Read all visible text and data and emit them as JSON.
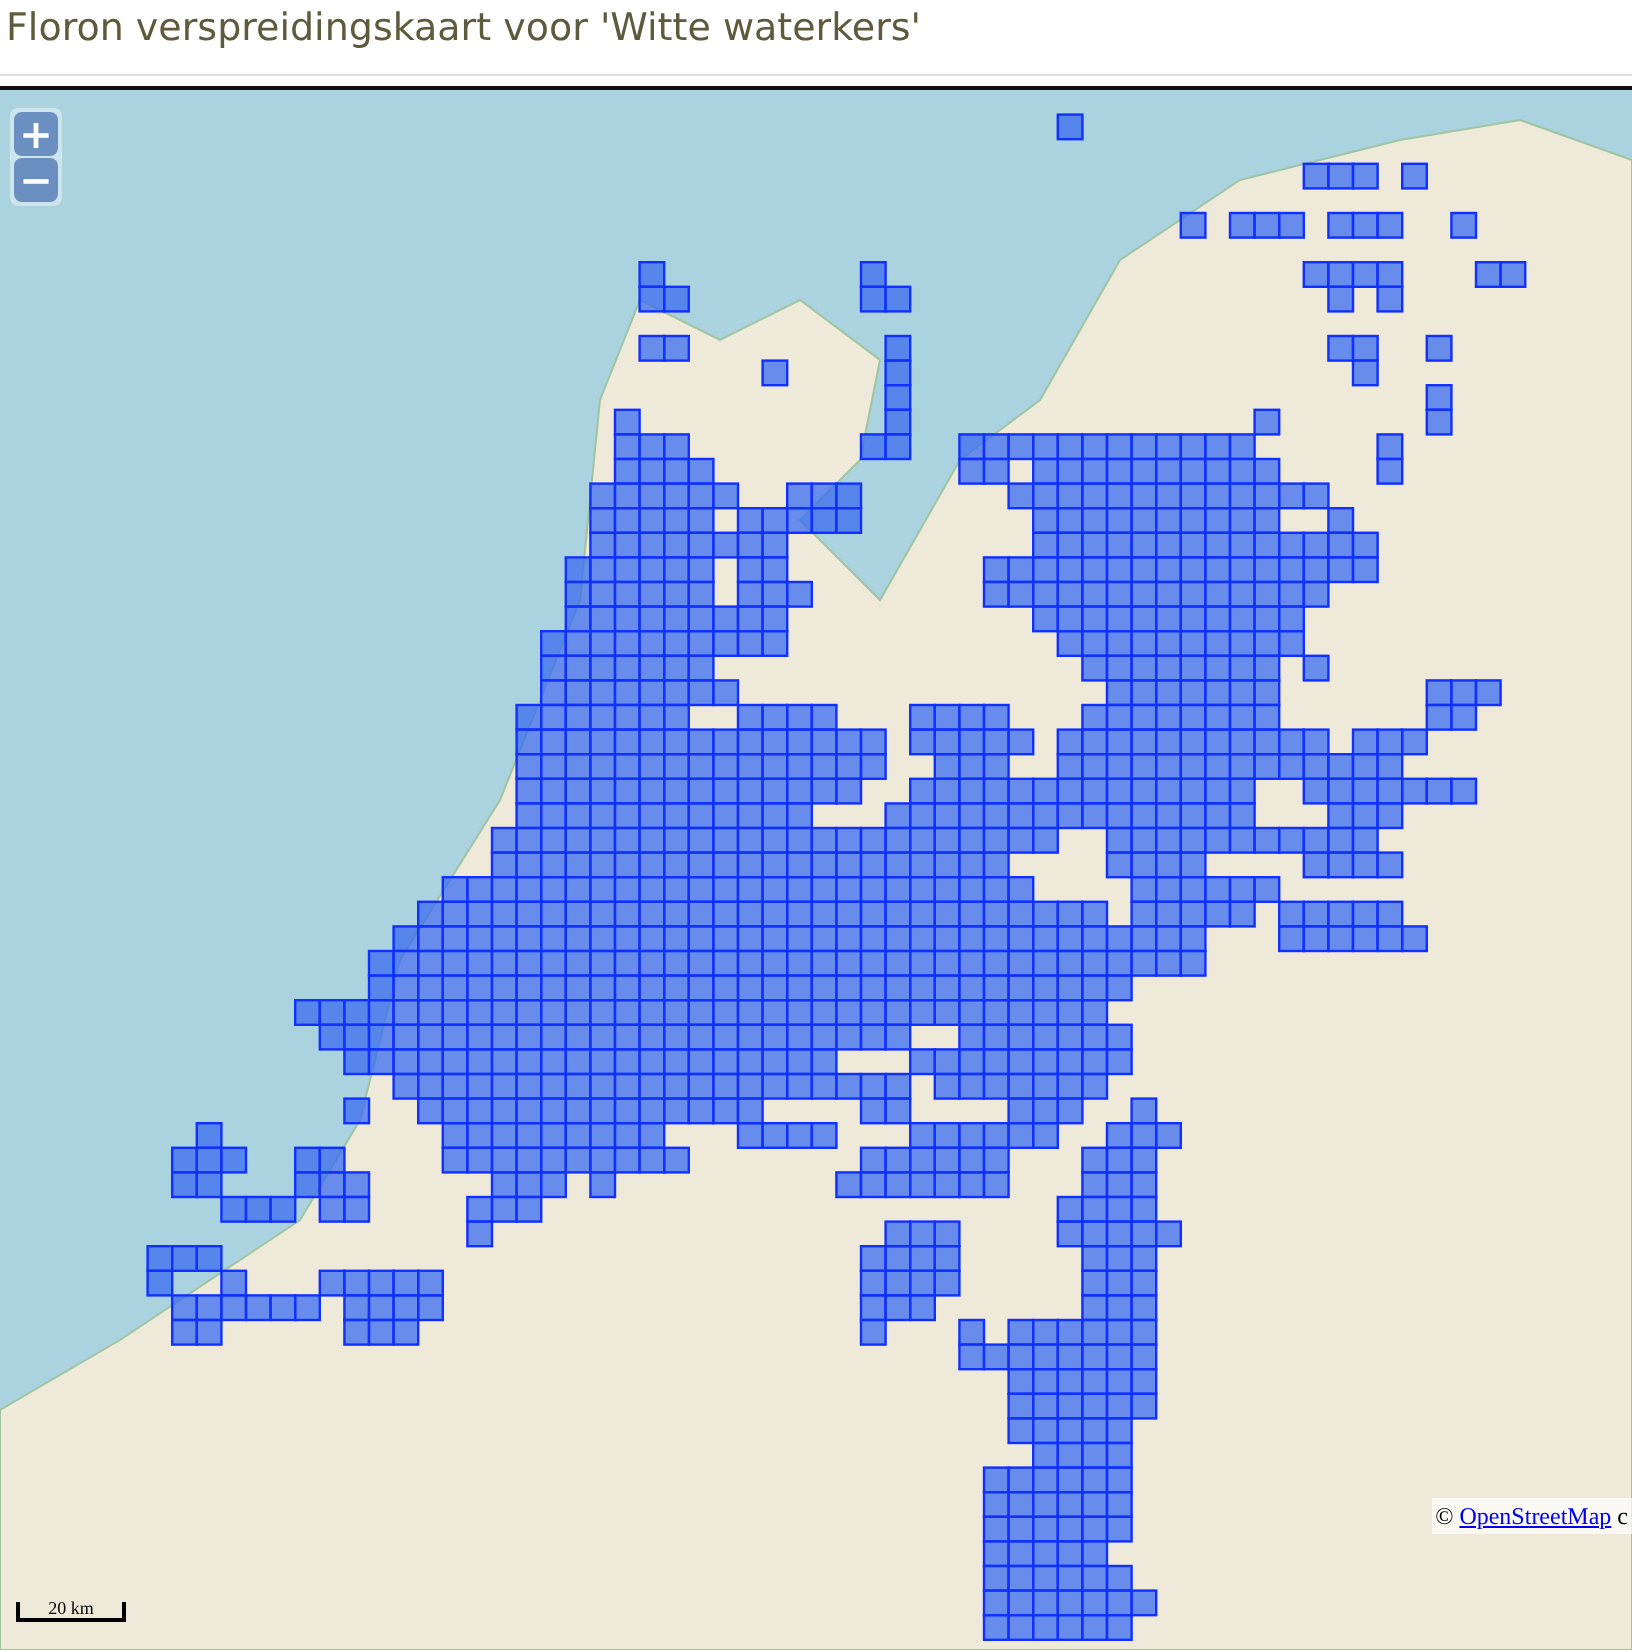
{
  "title": "Floron verspreidingskaart voor 'Witte waterkers'",
  "map": {
    "zoom_controls": [
      "+",
      "−"
    ],
    "attribution": {
      "symbol": "©",
      "link": "OpenStreetMap",
      "suffix": "c"
    },
    "scale": "20 km"
  }
}
